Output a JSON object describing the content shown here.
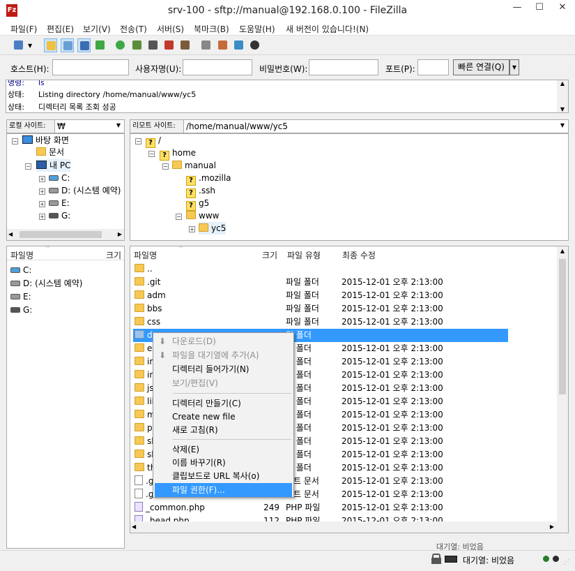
{
  "window": {
    "title": "srv-100 - sftp://manual@192.168.0.100 - FileZilla",
    "app_icon_text": "Fz",
    "minimize": "—",
    "maximize": "☐",
    "close": "✕"
  },
  "menu": [
    "파일(F)",
    "편집(E)",
    "보기(V)",
    "전송(T)",
    "서버(S)",
    "북마크(B)",
    "도움말(H)",
    "새 버전이 있습니다!(N)"
  ],
  "quickconnect": {
    "host_label": "호스트(H):",
    "user_label": "사용자명(U):",
    "pass_label": "비밀번호(W):",
    "port_label": "포트(P):",
    "connect_button": "빠른 연결(Q)",
    "dropdown": "▼",
    "host_value": "",
    "user_value": "",
    "pass_value": "",
    "port_value": ""
  },
  "log": [
    {
      "label": "명령:",
      "text": "ls"
    },
    {
      "label": "상태:",
      "text": "Listing directory /home/manual/www/yc5"
    },
    {
      "label": "상태:",
      "text": "디렉터리 목록 조회 성공"
    }
  ],
  "local": {
    "site_label": "로컬 사이트:",
    "path": "₩",
    "tree": [
      {
        "label": "바탕 화면",
        "icon": "desktop-icon"
      },
      {
        "label": "문서",
        "icon": "documents-icon"
      },
      {
        "label": "내 PC",
        "icon": "computer-icon"
      },
      {
        "label": "C:",
        "icon": "drive-icon"
      },
      {
        "label": "D: (시스템 예약)",
        "icon": "drive-icon"
      },
      {
        "label": "E:",
        "icon": "drive-icon"
      },
      {
        "label": "G:",
        "icon": "drive-icon"
      }
    ],
    "columns": {
      "name": "파일명",
      "size": "크기"
    },
    "files": [
      "C:",
      "D: (시스템 예약)",
      "E:",
      "G:"
    ]
  },
  "remote": {
    "site_label": "리모트 사이트:",
    "path": "/home/manual/www/yc5",
    "tree": [
      {
        "label": "/",
        "icon": "unknown-folder-icon"
      },
      {
        "label": "home",
        "icon": "unknown-folder-icon"
      },
      {
        "label": "manual",
        "icon": "folder-icon"
      },
      {
        "label": ".mozilla",
        "icon": "unknown-folder-icon"
      },
      {
        "label": ".ssh",
        "icon": "unknown-folder-icon"
      },
      {
        "label": "g5",
        "icon": "unknown-folder-icon"
      },
      {
        "label": "www",
        "icon": "folder-icon"
      },
      {
        "label": "yc5",
        "icon": "folder-icon"
      }
    ],
    "columns": {
      "name": "파일명",
      "size": "크기",
      "type": "파일 유형",
      "modified": "최종 수정"
    },
    "files": [
      {
        "name": "..",
        "size": "",
        "type": "",
        "modified": ""
      },
      {
        "name": ".git",
        "size": "",
        "type": "파일 폴더",
        "modified": "2015-12-01 오후 2:13:00"
      },
      {
        "name": "adm",
        "size": "",
        "type": "파일 폴더",
        "modified": "2015-12-01 오후 2:13:00"
      },
      {
        "name": "bbs",
        "size": "",
        "type": "파일 폴더",
        "modified": "2015-12-01 오후 2:13:00"
      },
      {
        "name": "css",
        "size": "",
        "type": "파일 폴더",
        "modified": "2015-12-01 오후 2:13:00"
      },
      {
        "name": "da",
        "size": "",
        "type": "일 폴더",
        "modified": ""
      },
      {
        "name": "ex",
        "size": "",
        "type": "일 폴더",
        "modified": "2015-12-01 오후 2:13:00"
      },
      {
        "name": "im",
        "size": "",
        "type": "일 폴더",
        "modified": "2015-12-01 오후 2:13:00"
      },
      {
        "name": "in",
        "size": "",
        "type": "일 폴더",
        "modified": "2015-12-01 오후 2:13:00"
      },
      {
        "name": "js",
        "size": "",
        "type": "일 폴더",
        "modified": "2015-12-01 오후 2:13:00"
      },
      {
        "name": "lib",
        "size": "",
        "type": "일 폴더",
        "modified": "2015-12-01 오후 2:13:00"
      },
      {
        "name": "m",
        "size": "",
        "type": "일 폴더",
        "modified": "2015-12-01 오후 2:13:00"
      },
      {
        "name": "pl",
        "size": "",
        "type": "일 폴더",
        "modified": "2015-12-01 오후 2:13:00"
      },
      {
        "name": "sh",
        "size": "",
        "type": "일 폴더",
        "modified": "2015-12-01 오후 2:13:00"
      },
      {
        "name": "sk",
        "size": "",
        "type": "일 폴더",
        "modified": "2015-12-01 오후 2:13:00"
      },
      {
        "name": "th",
        "size": "",
        "type": "일 폴더",
        "modified": "2015-12-01 오후 2:13:00"
      },
      {
        "name": ".g",
        "size": "",
        "type": "스트 문서",
        "modified": "2015-12-01 오후 2:13:00"
      },
      {
        "name": ".g",
        "size": "",
        "type": "스트 문서",
        "modified": "2015-12-01 오후 2:13:00"
      },
      {
        "name": "_common.php",
        "size": "249",
        "type": "PHP 파일",
        "modified": "2015-12-01 오후 2:13:00"
      },
      {
        "name": "_head.php",
        "size": "112",
        "type": "PHP 파일",
        "modified": "2015-12-01 오후 2:13:00"
      }
    ]
  },
  "context_menu": {
    "download": "다운로드(D)",
    "add_queue": "파일을 대기열에 추가(A)",
    "enter_dir": "디렉터리 들어가기(N)",
    "view_edit": "보기/편집(V)",
    "make_dir": "디렉터리 만들기(C)",
    "create_file": "Create new file",
    "refresh": "새로 고침(R)",
    "delete": "삭제(E)",
    "rename": "이름 바꾸기(R)",
    "copy_url": "클립보드로 URL 복사(o)",
    "permissions": "파일 권한(F)..."
  },
  "queue_label": "대기열: 비었음",
  "status": {
    "queue": "대기열: 비었음"
  }
}
